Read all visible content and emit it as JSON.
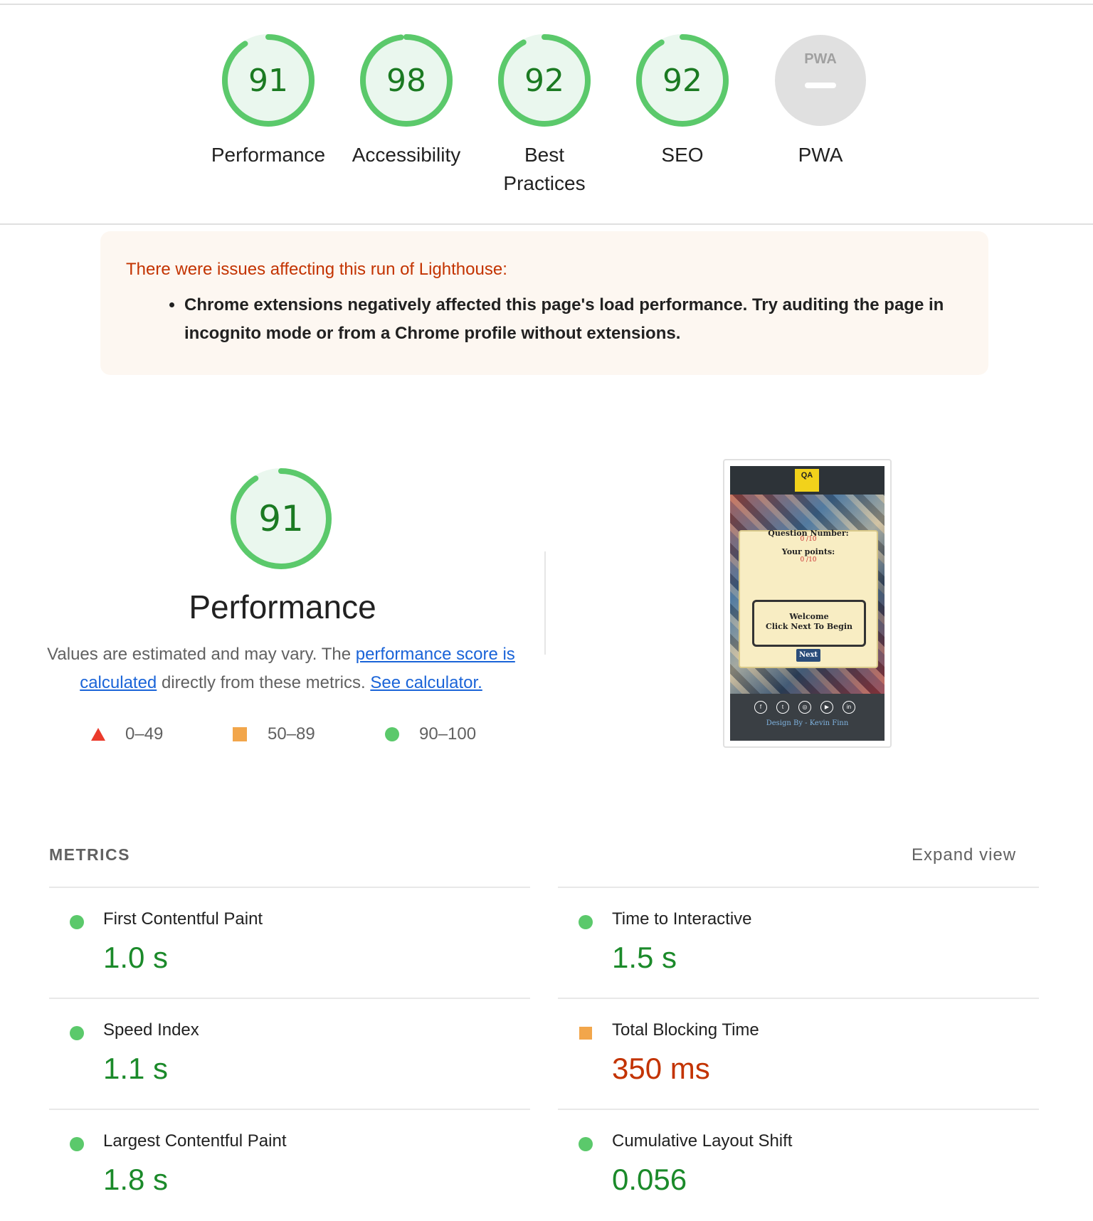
{
  "colors": {
    "pass": "#0cce6b",
    "pass_text": "#1b7a22",
    "average": "#ffa400",
    "fail": "#ff4e42",
    "na": "#e0e0e0"
  },
  "gauges": [
    {
      "score": "91",
      "label": "Performance"
    },
    {
      "score": "98",
      "label": "Accessibility"
    },
    {
      "score": "92",
      "label": "Best Practices"
    },
    {
      "score": "92",
      "label": "SEO"
    },
    {
      "score": "",
      "label": "PWA",
      "icon": "pwa-icon",
      "icon_text": "PWA"
    }
  ],
  "warning": {
    "title": "There were issues affecting this run of Lighthouse:",
    "items": [
      "Chrome extensions negatively affected this page's load performance. Try auditing the page in incognito mode or from a Chrome profile without extensions."
    ]
  },
  "performance": {
    "score": "91",
    "title": "Performance",
    "desc_prefix": "Values are estimated and may vary. The ",
    "link_score": "performance score is calculated",
    "desc_middle": " directly from these metrics. ",
    "link_calculator": "See calculator."
  },
  "legend": [
    {
      "shape": "triangle",
      "range": "0–49"
    },
    {
      "shape": "square",
      "range": "50–89"
    },
    {
      "shape": "circle",
      "range": "90–100"
    }
  ],
  "screenshot": {
    "logo": "QA",
    "question_label": "Question Number:",
    "question_value": "0 /10",
    "points_label": "Your points:",
    "points_value": "0 /10",
    "welcome": "Welcome",
    "instruction": "Click Next To Begin",
    "next": "Next",
    "credit": "Design By - Kevin Finn",
    "social_icons": [
      "facebook-icon",
      "twitter-icon",
      "instagram-icon",
      "youtube-icon",
      "linkedin-icon"
    ]
  },
  "metrics": {
    "heading": "METRICS",
    "expand": "Expand view",
    "items": [
      {
        "name": "First Contentful Paint",
        "value": "1.0 s",
        "status": "pass"
      },
      {
        "name": "Time to Interactive",
        "value": "1.5 s",
        "status": "pass"
      },
      {
        "name": "Speed Index",
        "value": "1.1 s",
        "status": "pass"
      },
      {
        "name": "Total Blocking Time",
        "value": "350 ms",
        "status": "average"
      },
      {
        "name": "Largest Contentful Paint",
        "value": "1.8 s",
        "status": "pass"
      },
      {
        "name": "Cumulative Layout Shift",
        "value": "0.056",
        "status": "pass"
      }
    ]
  }
}
